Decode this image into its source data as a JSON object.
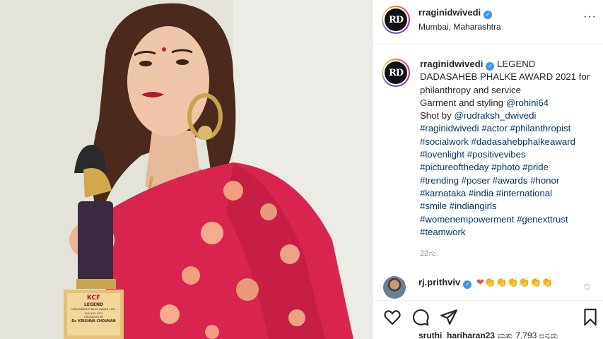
{
  "post": {
    "username": "rraginidwivedi",
    "location": "Mumbai, Maharashtra",
    "avatar_text": "RD",
    "more_label": "···"
  },
  "caption": {
    "username": "rraginidwivedi",
    "lines": [
      "LEGEND",
      "DADASAHEB PHALKE AWARD 2021 for",
      "philanthropy and service",
      "Garment and styling @rohini64",
      "Shot by @rudraksh_dwivedi",
      "#raginidwivedi #actor #philanthropist",
      "#socialwork #dadasahebphalkeaward",
      "#lovenlight #positivevibes",
      "#pictureoftheday #photo #pride",
      "#trending #poser #awards #honor",
      "#karnataka #india #international",
      "#smile #indiangirls",
      "#womenempowerment #genexttrust",
      "#teamwork"
    ],
    "time": "22ಗಂ."
  },
  "comment": {
    "username": "rj.prithviv",
    "text": "❤👏👏👏👏👏👏"
  },
  "likes": {
    "user": "sruthi_hariharan23",
    "text": " ಮತ್ತು 7,793 ಅನ್ಯರು"
  },
  "trophy": {
    "brand": "KCF",
    "line1": "LEGEND",
    "line2": "DADASAHEB PHALKE AWARD 2021",
    "line3": "11th JULY 2021",
    "line4": "ORGANISED BY",
    "line5": "Dr. KRISHNA CHOUHAN"
  },
  "colors": {
    "link": "#00376b",
    "verified": "#3897f0",
    "saree": "#d8244f",
    "heart": "#ed4956"
  },
  "icons": [
    "verified-icon",
    "more-icon",
    "heart-icon",
    "comment-icon",
    "share-icon",
    "bookmark-icon",
    "comment-like-icon"
  ]
}
